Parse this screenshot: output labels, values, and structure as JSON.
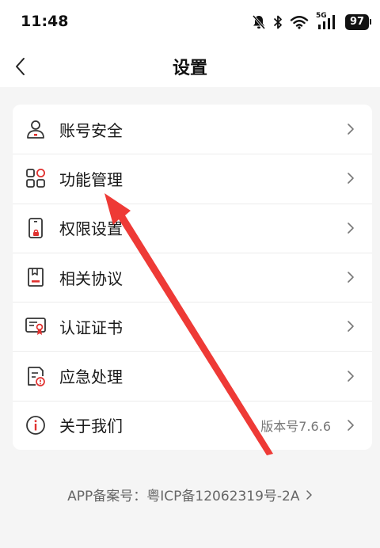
{
  "status_bar": {
    "time": "11:48",
    "network_tag": "5G",
    "battery": "97"
  },
  "nav": {
    "title": "设置"
  },
  "menu": {
    "items": [
      {
        "label": "账号安全",
        "icon": "user-icon",
        "value": ""
      },
      {
        "label": "功能管理",
        "icon": "grid-icon",
        "value": ""
      },
      {
        "label": "权限设置",
        "icon": "phone-lock-icon",
        "value": ""
      },
      {
        "label": "相关协议",
        "icon": "document-icon",
        "value": ""
      },
      {
        "label": "认证证书",
        "icon": "certificate-icon",
        "value": ""
      },
      {
        "label": "应急处理",
        "icon": "emergency-doc-icon",
        "value": ""
      },
      {
        "label": "关于我们",
        "icon": "info-icon",
        "value": "版本号7.6.6"
      }
    ]
  },
  "footer": {
    "text": "APP备案号：粤ICP备12062319号-2A"
  },
  "colors": {
    "accent": "#e0312f",
    "annotation_arrow": "#ee3a36",
    "background": "#f5f5f5"
  }
}
